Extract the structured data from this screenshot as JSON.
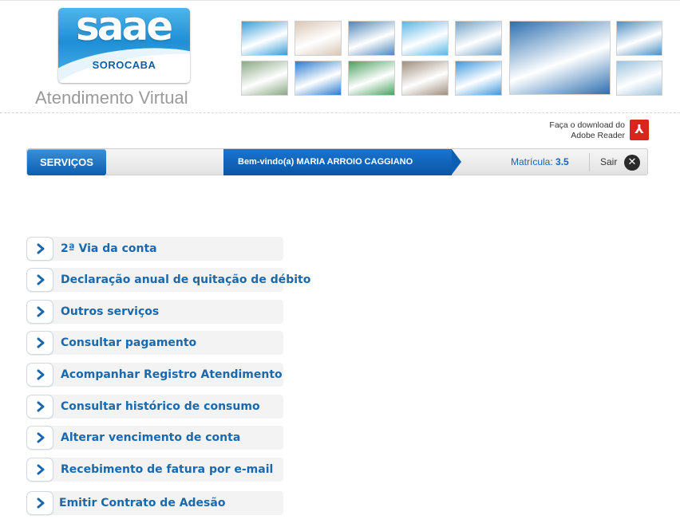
{
  "header": {
    "logo": {
      "word": "saae",
      "city": "SOROCABA"
    },
    "title": "Atendimento Virtual",
    "photo_colors": [
      "#3a9fd8",
      "#d9c7b6",
      "#4f86b8",
      "#5bb6e6",
      "#6fa2c7",
      "#2d6fb0",
      "#4d8fc0",
      "#8aa884",
      "#2a7bd0",
      "#4aa15f",
      "#9f8f7e",
      "#3e99e0",
      "#9dc3de"
    ]
  },
  "adobe": {
    "line1": "Faça o download do",
    "line2": "Adobe Reader",
    "icon": "pdf-icon"
  },
  "navbar": {
    "services_label": "SERVIÇOS",
    "welcome": "Bem-vindo(a) MARIA ARROIO CAGGIANO",
    "matricula_label": "Matrícula:",
    "matricula_value": "3.5",
    "logout_label": "Sair",
    "logout_icon": "close-icon"
  },
  "menu": {
    "items": [
      {
        "label": "2ª Via da conta"
      },
      {
        "label": "Declaração anual de quitação de débito"
      },
      {
        "label": "Outros serviços"
      },
      {
        "label": "Consultar pagamento"
      },
      {
        "label": "Acompanhar Registro Atendimento"
      },
      {
        "label": "Consultar histórico de consumo"
      },
      {
        "label": "Alterar vencimento de conta"
      },
      {
        "label": "Recebimento de fatura por e-mail"
      },
      {
        "label": "Emitir Contrato de Adesão"
      }
    ]
  }
}
